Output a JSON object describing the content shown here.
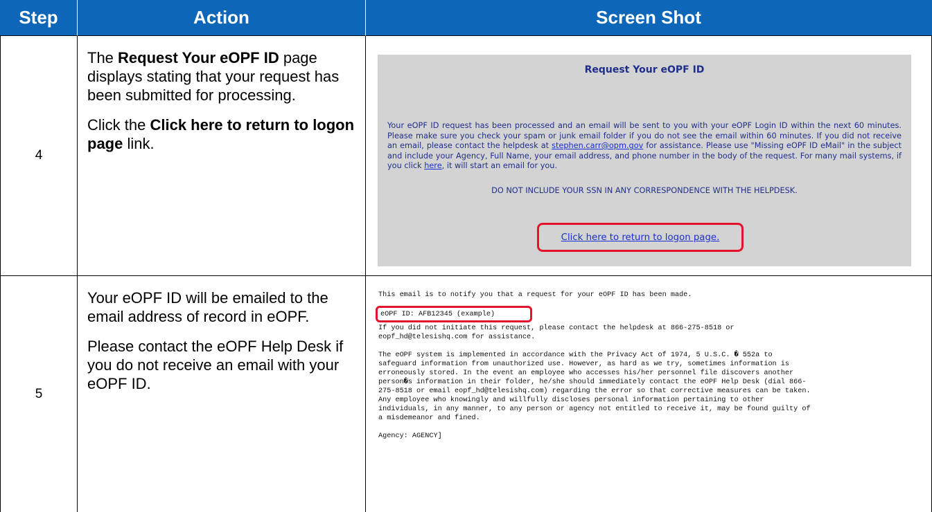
{
  "header": {
    "step": "Step",
    "action": "Action",
    "screenshot": "Screen Shot"
  },
  "rows": [
    {
      "step": "4",
      "action": {
        "p1_pre": "The ",
        "p1_bold": "Request Your eOPF ID",
        "p1_post": " page displays stating that your request has been submitted for processing.",
        "p2_pre": "Click the ",
        "p2_bold": "Click here to return to logon page",
        "p2_post": " link."
      },
      "screenshot": {
        "title": "Request Your eOPF ID",
        "body_1": "Your eOPF ID request has been processed and an email will be sent to you with your eOPF Login ID within the next 60 minutes. Please make sure you check your spam or junk email folder if you do not see the email within 60 minutes. If you did not receive an email, please contact the helpdesk at ",
        "email_link": "stephen.carr@opm.gov",
        "body_2": " for assistance. Please use \"Missing eOPF ID eMail\" in the subject and include your Agency, Full Name, your email address, and phone number in the body of the request. For many mail systems, if you click ",
        "here_link": "here",
        "body_3": ", it will start an email for you.",
        "warning": "DO NOT INCLUDE YOUR SSN IN ANY CORRESPONDENCE WITH THE HELPDESK.",
        "return_link": "Click here to return to logon page."
      }
    },
    {
      "step": "5",
      "action": {
        "p1": "Your eOPF ID will be emailed to the email address of record in eOPF.",
        "p2": "Please contact the eOPF Help Desk if you do not receive an email with your eOPF ID."
      },
      "screenshot": {
        "line1": "This email is to notify you that a request for your eOPF ID has been made.",
        "id_line": "eOPF ID: AFB12345 (example)",
        "contact_1": "If you did not initiate this request, please contact the helpdesk at 866-275-8518 or",
        "contact_2": "eopf_hd@telesishq.com for assistance.",
        "privacy_1": "The eOPF system is implemented in accordance with the Privacy Act of 1974, 5 U.S.C. � 552a to",
        "privacy_2": "safeguard information from unauthorized use. However, as hard as we try, sometimes information is",
        "privacy_3": "erroneously stored. In the event an employee who accesses his/her personnel file discovers another",
        "privacy_4": "person�s information in their folder, he/she should immediately contact the eOPF Help Desk (dial 866-",
        "privacy_5": "275-8518 or email eopf_hd@telesishq.com) regarding the error so that corrective measures can be taken.",
        "privacy_6": "Any employee who knowingly and willfully discloses personal information pertaining to other",
        "privacy_7": "individuals, in any manner, to any person or agency not entitled to receive it, may be found guilty of",
        "privacy_8": "a misdemeanor and fined.",
        "agency": "Agency: AGENCY]"
      }
    }
  ],
  "colors": {
    "header_bg": "#0d66b8",
    "panel_bg": "#d3d3d3",
    "highlight": "#e3142a",
    "link": "#1a2fd1",
    "panel_text": "#1f2e8c"
  }
}
